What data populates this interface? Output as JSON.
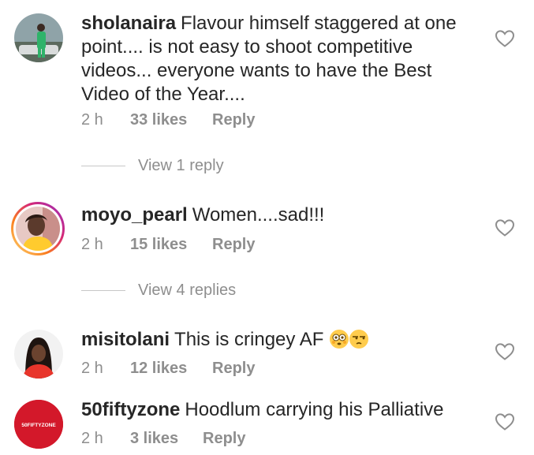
{
  "comments": [
    {
      "username": "sholanaira",
      "text": "Flavour himself staggered at one point.... is not easy to shoot competitive videos... everyone wants to have the Best Video of the Year....",
      "time": "2 h",
      "likes": "33 likes",
      "reply": "Reply",
      "view_replies": "View 1 reply"
    },
    {
      "username": "moyo_pearl",
      "text": "Women....sad!!!",
      "time": "2 h",
      "likes": "15 likes",
      "reply": "Reply",
      "view_replies": "View 4 replies"
    },
    {
      "username": "misitolani",
      "text": "This is cringey AF",
      "emojis": [
        "flushed-face-emoji",
        "unamused-face-emoji"
      ],
      "time": "2 h",
      "likes": "12 likes",
      "reply": "Reply"
    },
    {
      "username": "50fiftyzone",
      "text": "Hoodlum carrying his Palliative",
      "avatar_logo_text": "50FIFTYZONE",
      "time": "2 h",
      "likes": "3 likes",
      "reply": "Reply"
    }
  ],
  "colors": {
    "text": "#262626",
    "secondary": "#8e8e8e",
    "logo_red": "#d3182a"
  }
}
